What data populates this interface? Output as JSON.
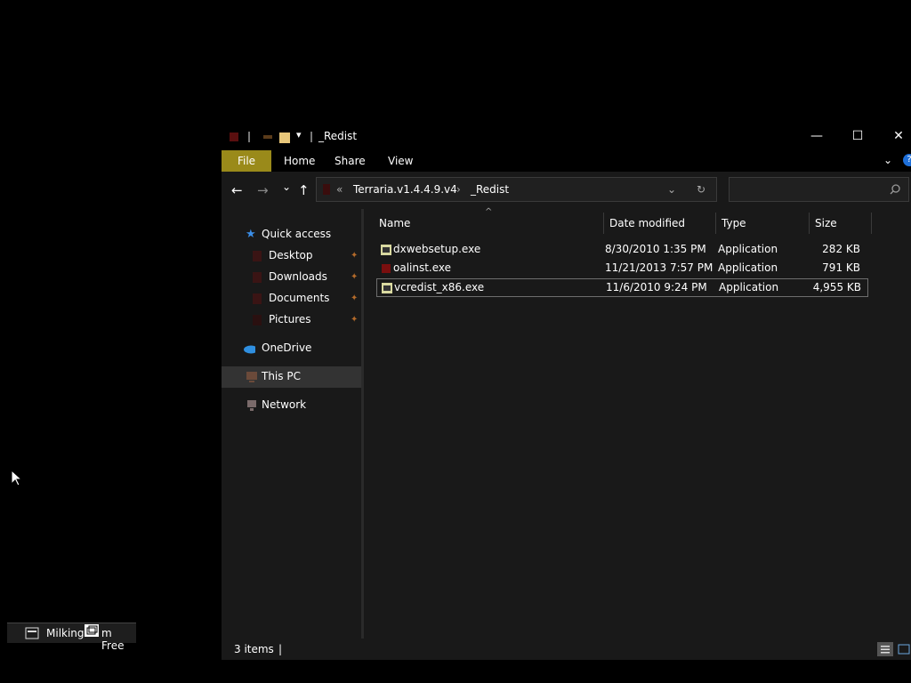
{
  "window": {
    "title": "_Redist",
    "minimize": "—",
    "maximize": "☐",
    "close": "✕",
    "help": "?"
  },
  "ribbon": {
    "tabs": [
      "File",
      "Home",
      "Share",
      "View"
    ]
  },
  "nav": {
    "back": "←",
    "forward": "→",
    "recent": "⌄",
    "up": "↑",
    "path_prefix": "«",
    "path": [
      "Terraria.v1.4.4.9.v4",
      "_Redist"
    ],
    "path_sep": "›",
    "dropdown": "⌄",
    "refresh": "↻",
    "search_placeholder": ""
  },
  "sidebar": {
    "items": [
      {
        "label": "Quick access",
        "icon": "star-icon"
      },
      {
        "label": "Desktop",
        "icon": "desktop-icon"
      },
      {
        "label": "Downloads",
        "icon": "downloads-icon"
      },
      {
        "label": "Documents",
        "icon": "documents-icon"
      },
      {
        "label": "Pictures",
        "icon": "pictures-icon"
      },
      {
        "label": "OneDrive",
        "icon": "cloud-icon"
      },
      {
        "label": "This PC",
        "icon": "computer-icon"
      },
      {
        "label": "Network",
        "icon": "network-icon"
      }
    ]
  },
  "columns": {
    "name": "Name",
    "date": "Date modified",
    "type": "Type",
    "size": "Size"
  },
  "files": [
    {
      "name": "dxwebsetup.exe",
      "date": "8/30/2010 1:35 PM",
      "type": "Application",
      "size": "282 KB"
    },
    {
      "name": "oalinst.exe",
      "date": "11/21/2013 7:57 PM",
      "type": "Application",
      "size": "791 KB"
    },
    {
      "name": "vcredist_x86.exe",
      "date": "11/6/2010 9:24 PM",
      "type": "Application",
      "size": "4,955 KB"
    }
  ],
  "status": {
    "items": "3 items",
    "divider": "|"
  },
  "taskbar": {
    "label": "Milking",
    "label_end": "m Free"
  },
  "colors": {
    "file_tab": "#9a8a1a",
    "background": "#191919"
  }
}
